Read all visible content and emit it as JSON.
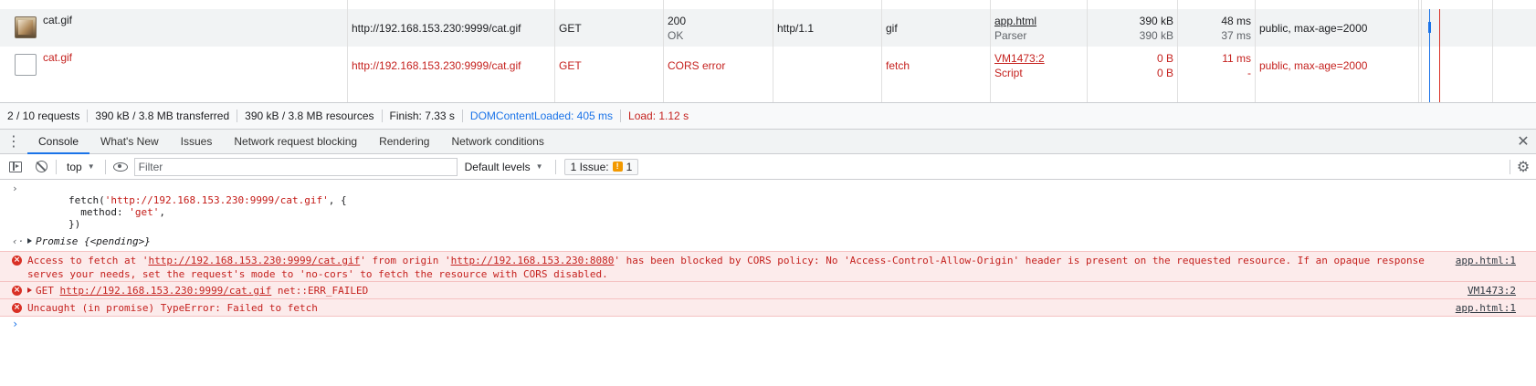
{
  "network": {
    "rows": [
      {
        "name": "cat.gif",
        "url": "http://192.168.153.230:9999/cat.gif",
        "method": "GET",
        "status": "200",
        "status_text": "OK",
        "protocol": "http/1.1",
        "type": "gif",
        "initiator": "app.html",
        "initiator_sub": "Parser",
        "size": "390 kB",
        "size_sub": "390 kB",
        "time": "48 ms",
        "time_sub": "37 ms",
        "cache_control": "public, max-age=2000"
      },
      {
        "name": "cat.gif",
        "url": "http://192.168.153.230:9999/cat.gif",
        "method": "GET",
        "status": "CORS error",
        "protocol": "",
        "type": "fetch",
        "initiator": "VM1473:2",
        "initiator_sub": "Script",
        "size": "0 B",
        "size_sub": "0 B",
        "time": "11 ms",
        "time_sub": "-",
        "cache_control": "public, max-age=2000"
      }
    ]
  },
  "status_bar": {
    "requests": "2 / 10 requests",
    "transferred": "390 kB / 3.8 MB transferred",
    "resources": "390 kB / 3.8 MB resources",
    "finish": "Finish: 7.33 s",
    "dcl": "DOMContentLoaded: 405 ms",
    "load": "Load: 1.12 s"
  },
  "drawer": {
    "tabs": [
      "Console",
      "What's New",
      "Issues",
      "Network request blocking",
      "Rendering",
      "Network conditions"
    ],
    "active_tab": "Console"
  },
  "console_toolbar": {
    "context": "top",
    "filter_placeholder": "Filter",
    "levels": "Default levels",
    "issues_label": "1 Issue:",
    "issues_count": "1"
  },
  "console": {
    "input": {
      "line1_pre": "fetch(",
      "line1_str": "'http://192.168.153.230:9999/cat.gif'",
      "line1_post": ", {",
      "line2_pre": "  method: ",
      "line2_str": "'get'",
      "line2_post": ",",
      "line3": "})"
    },
    "result": "Promise {<pending>}",
    "errors": {
      "cors": {
        "p1": "Access to fetch at '",
        "url1": "http://192.168.153.230:9999/cat.gif",
        "p2": "' from origin '",
        "url2": "http://192.168.153.230:8080",
        "p3": "' has been blocked by CORS policy: No 'Access-Control-Allow-Origin' header is present on the requested resource. If an opaque response serves your needs, set the request's mode to 'no-cors' to fetch the resource with CORS disabled.",
        "source": "app.html:1"
      },
      "get": {
        "method": "GET",
        "url": "http://192.168.153.230:9999/cat.gif",
        "code": "net::ERR_FAILED",
        "source": "VM1473:2"
      },
      "uncaught": {
        "text": "Uncaught (in promise) TypeError: Failed to fetch",
        "source": "app.html:1"
      }
    }
  },
  "colors": {
    "accent": "#1a73e8",
    "error": "#c5221f",
    "error_bg": "#fcebeb"
  }
}
